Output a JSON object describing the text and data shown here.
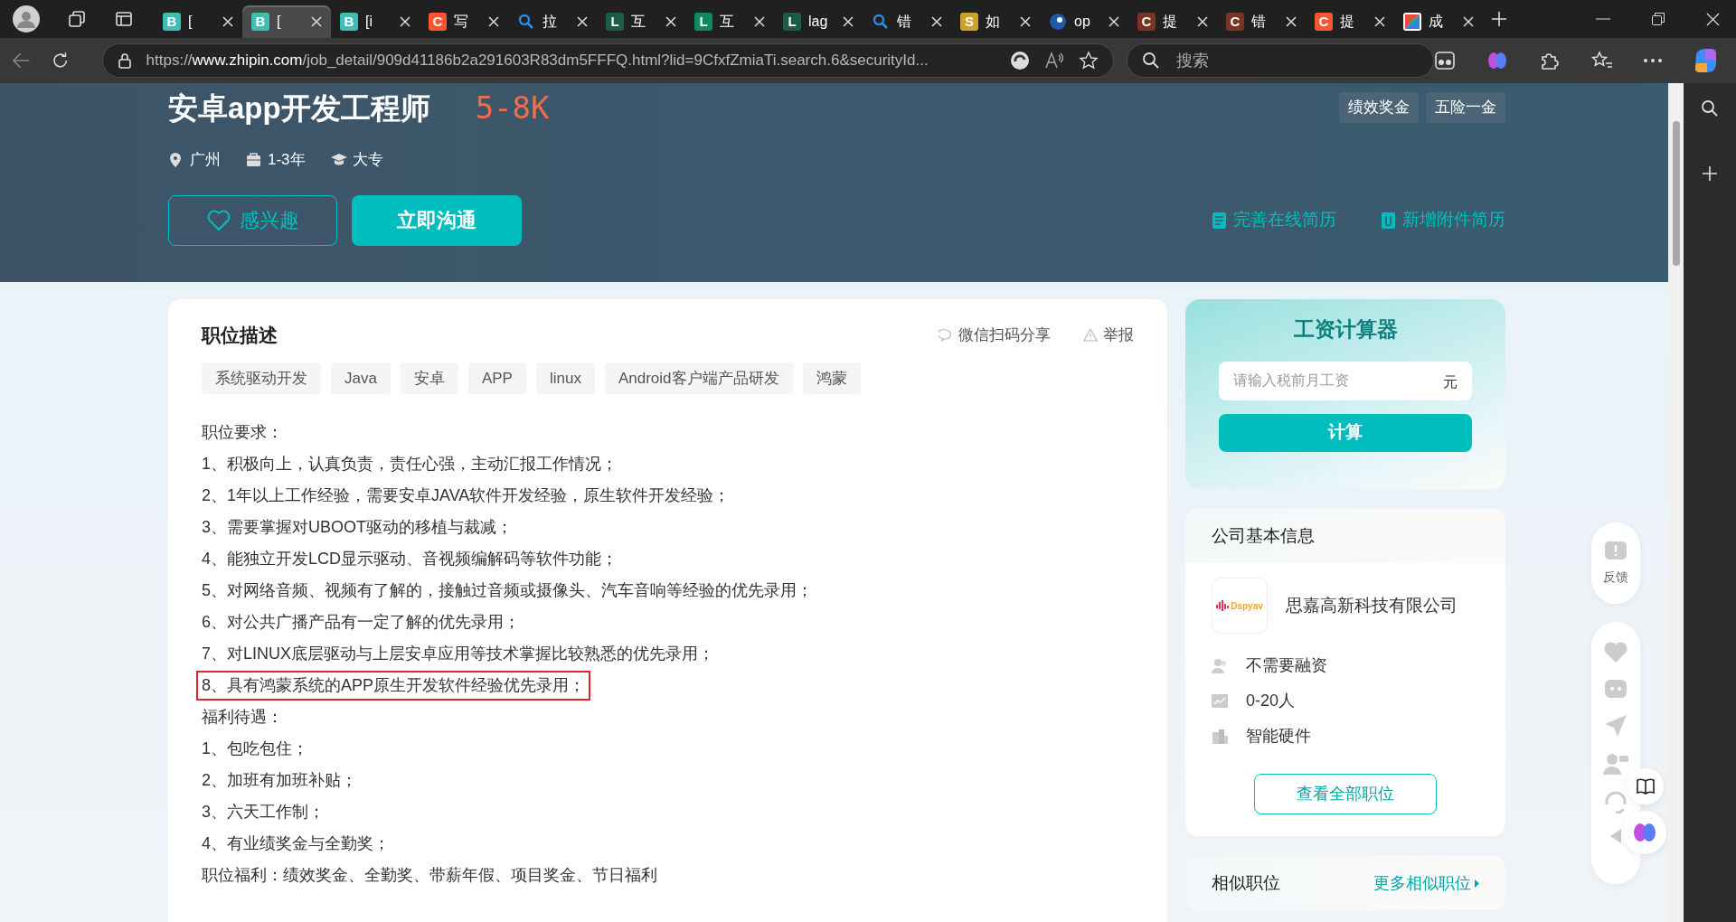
{
  "browser": {
    "tabs": [
      {
        "favicon": {
          "kind": "letter",
          "letter": "B",
          "color": "#3fbfb4"
        },
        "title": "[",
        "selected": false
      },
      {
        "favicon": {
          "kind": "letter",
          "letter": "B",
          "color": "#3fbfb4"
        },
        "title": "[",
        "selected": true
      },
      {
        "favicon": {
          "kind": "letter",
          "letter": "B",
          "color": "#3fbfb4"
        },
        "title": "[i",
        "selected": false
      },
      {
        "favicon": {
          "kind": "letter",
          "letter": "C",
          "color": "#fc5531"
        },
        "title": "写",
        "selected": false
      },
      {
        "favicon": {
          "kind": "search"
        },
        "title": "拉",
        "selected": false
      },
      {
        "favicon": {
          "kind": "letter",
          "letter": "L",
          "color": "#1d5b45"
        },
        "title": "互",
        "selected": false
      },
      {
        "favicon": {
          "kind": "letter",
          "letter": "L",
          "color": "#0f8a5f"
        },
        "title": "互",
        "selected": false
      },
      {
        "favicon": {
          "kind": "letter",
          "letter": "L",
          "color": "#1d5b45"
        },
        "title": "lag",
        "selected": false
      },
      {
        "favicon": {
          "kind": "search"
        },
        "title": "错",
        "selected": false
      },
      {
        "favicon": {
          "kind": "letter",
          "letter": "S",
          "color": "#c9a227"
        },
        "title": "如",
        "selected": false
      },
      {
        "favicon": {
          "kind": "swirl"
        },
        "title": "op",
        "selected": false
      },
      {
        "favicon": {
          "kind": "letter",
          "letter": "C",
          "color": "#7a3424"
        },
        "title": "提",
        "selected": false
      },
      {
        "favicon": {
          "kind": "letter",
          "letter": "C",
          "color": "#7a3424"
        },
        "title": "错",
        "selected": false
      },
      {
        "favicon": {
          "kind": "letter",
          "letter": "C",
          "color": "#fc5531"
        },
        "title": "提",
        "selected": false
      },
      {
        "favicon": {
          "kind": "mosaic"
        },
        "title": "成",
        "selected": false
      }
    ],
    "url": {
      "scheme": "https://",
      "host": "www.zhipin.com",
      "path": "/job_detail/909d41186b2a291603R83dm5FFFQ.html?lid=9CfxfZmiaTi.search.6&securityId..."
    },
    "search_placeholder": "搜索"
  },
  "job": {
    "title": "安卓app开发工程师",
    "salary": "5-8K",
    "welfare_tags": [
      "绩效奖金",
      "五险一金"
    ],
    "meta": [
      {
        "kind": "location",
        "text": "广州"
      },
      {
        "kind": "experience",
        "text": "1-3年"
      },
      {
        "kind": "degree",
        "text": "大专"
      }
    ],
    "interest_button": "感兴趣",
    "chat_button": "立即沟通",
    "resume_links": [
      {
        "kind": "online",
        "text": "完善在线简历"
      },
      {
        "kind": "attachment",
        "text": "新增附件简历"
      }
    ]
  },
  "description": {
    "heading": "职位描述",
    "share": "微信扫码分享",
    "report": "举报",
    "skill_tags": [
      "系统驱动开发",
      "Java",
      "安卓",
      "APP",
      "linux",
      "Android客户端产品研发",
      "鸿蒙"
    ],
    "lines": [
      {
        "text": "职位要求：",
        "highlighted": false
      },
      {
        "text": "1、积极向上，认真负责，责任心强，主动汇报工作情况；",
        "highlighted": false
      },
      {
        "text": "2、1年以上工作经验，需要安卓JAVA软件开发经验，原生软件开发经验；",
        "highlighted": false
      },
      {
        "text": "3、需要掌握对UBOOT驱动的移植与裁减；",
        "highlighted": false
      },
      {
        "text": "4、能独立开发LCD显示驱动、音视频编解码等软件功能；",
        "highlighted": false
      },
      {
        "text": "5、对网络音频、视频有了解的，接触过音频或摄像头、汽车音响等经验的优先录用；",
        "highlighted": false
      },
      {
        "text": "6、对公共广播产品有一定了解的优先录用；",
        "highlighted": false
      },
      {
        "text": "7、对LINUX底层驱动与上层安卓应用等技术掌握比较熟悉的优先录用；",
        "highlighted": false
      },
      {
        "text": "8、具有鸿蒙系统的APP原生开发软件经验优先录用；",
        "highlighted": true
      },
      {
        "text": "福利待遇：",
        "highlighted": false
      },
      {
        "text": "1、包吃包住；",
        "highlighted": false
      },
      {
        "text": "2、加班有加班补贴；",
        "highlighted": false
      },
      {
        "text": "3、六天工作制；",
        "highlighted": false
      },
      {
        "text": "4、有业绩奖金与全勤奖；",
        "highlighted": false
      },
      {
        "text": "职位福利：绩效奖金、全勤奖、带薪年假、项目奖金、节日福利",
        "highlighted": false
      }
    ]
  },
  "salary_calculator": {
    "title": "工资计算器",
    "placeholder": "请输入税前月工资",
    "unit": "元",
    "button": "计算"
  },
  "company": {
    "heading": "公司基本信息",
    "logo_text": "Dspyav",
    "name": "思嘉高新科技有限公司",
    "facts": [
      {
        "kind": "funding",
        "text": "不需要融资"
      },
      {
        "kind": "size",
        "text": "0-20人"
      },
      {
        "kind": "industry",
        "text": "智能硬件"
      }
    ],
    "button": "查看全部职位"
  },
  "similar_jobs": {
    "heading": "相似职位",
    "more_link": "更多相似职位"
  },
  "float_toolbar": {
    "feedback": "反馈"
  }
}
